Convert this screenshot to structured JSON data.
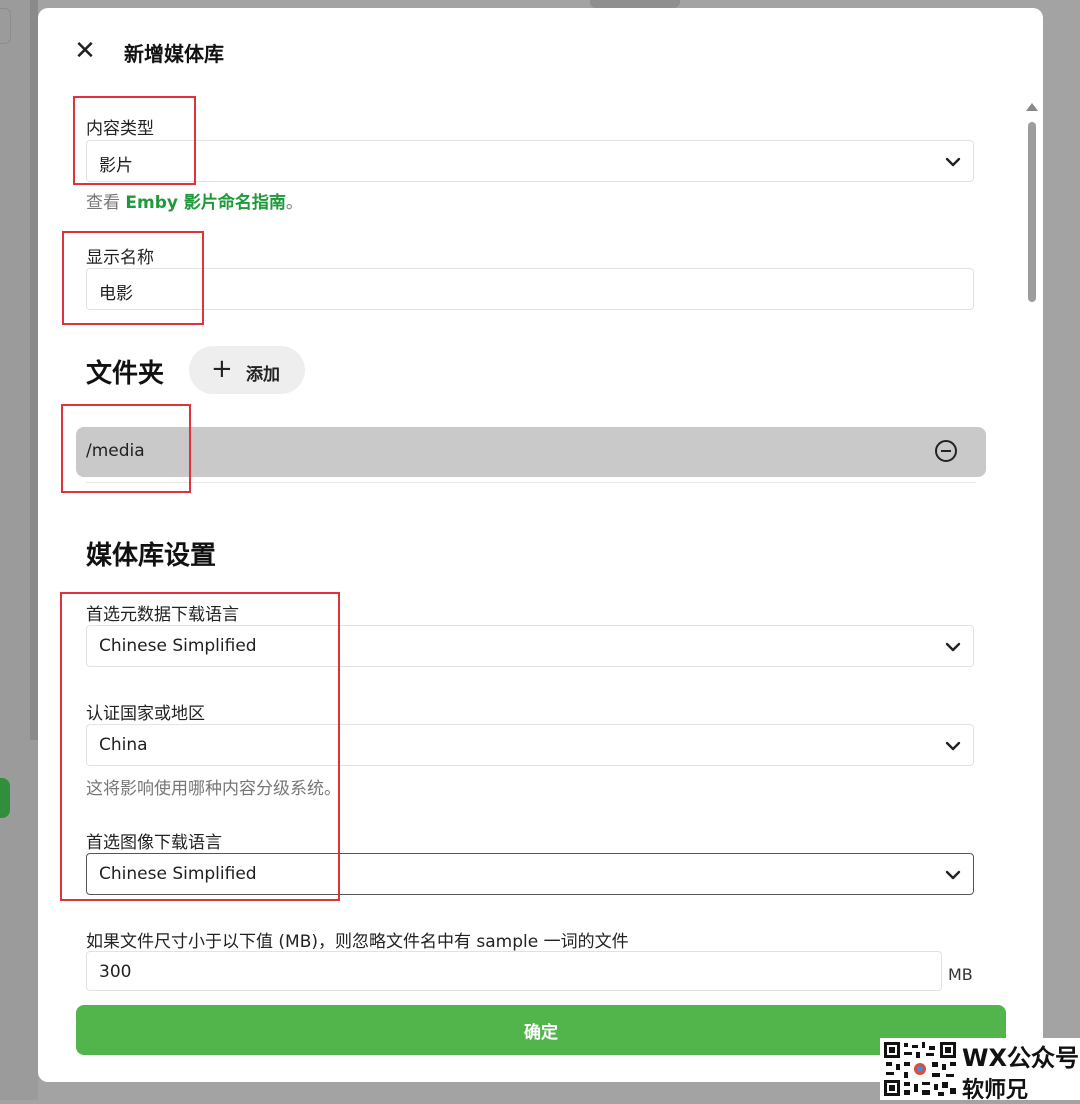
{
  "dialog": {
    "title": "新增媒体库",
    "close_icon": "close-icon"
  },
  "content_type": {
    "label": "内容类型",
    "value": "影片",
    "hint_prefix": "查看 ",
    "hint_link": "Emby 影片命名指南",
    "hint_suffix": "。"
  },
  "display_name": {
    "label": "显示名称",
    "value": "电影"
  },
  "folders": {
    "heading": "文件夹",
    "add_icon": "+",
    "add_label": "添加",
    "items": [
      {
        "path": "/media",
        "remove_icon": "minus-circle-icon"
      }
    ]
  },
  "library_settings": {
    "heading": "媒体库设置",
    "metadata_language": {
      "label": "首选元数据下载语言",
      "value": "Chinese Simplified"
    },
    "country": {
      "label": "认证国家或地区",
      "value": "China",
      "hint": "这将影响使用哪种内容分级系统。"
    },
    "image_language": {
      "label": "首选图像下载语言",
      "value": "Chinese Simplified"
    },
    "sample_size": {
      "label": "如果文件尺寸小于以下值 (MB)，则忽略文件名中有 sample 一词的文件",
      "value": "300",
      "unit": "MB"
    }
  },
  "confirm_button": "确定",
  "watermark": {
    "line1": "WX公众号",
    "line2": "软师兄"
  },
  "colors": {
    "accent_green": "#52b54b",
    "link_green": "#1f9a3a",
    "annotation_red": "#e0323a"
  }
}
